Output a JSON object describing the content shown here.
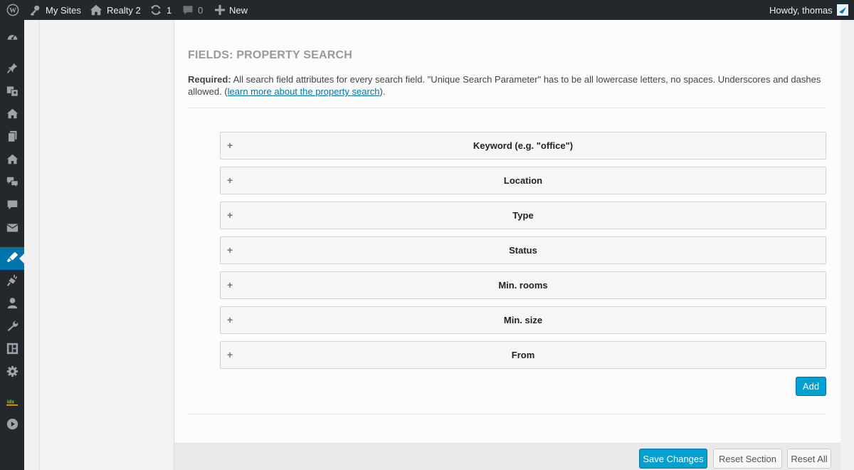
{
  "adminbar": {
    "wp_logo": "wordpress-icon",
    "my_sites": "My Sites",
    "site_name": "Realty 2",
    "updates_count": "1",
    "comments_count": "0",
    "new_label": "New",
    "howdy": "Howdy, thomas"
  },
  "menu": {
    "items": [
      {
        "icon": "dashboard-icon"
      },
      {
        "icon": "pin-icon"
      },
      {
        "icon": "media-icon"
      },
      {
        "icon": "home-icon"
      },
      {
        "icon": "pages-icon"
      },
      {
        "icon": "home-icon"
      },
      {
        "icon": "testimonials-icon"
      },
      {
        "icon": "comments-icon"
      },
      {
        "icon": "mail-icon"
      },
      {
        "icon": "appearance-icon",
        "current": true
      },
      {
        "icon": "plugins-icon"
      },
      {
        "icon": "users-icon"
      },
      {
        "icon": "tools-icon"
      },
      {
        "icon": "widgets-icon"
      },
      {
        "icon": "settings-icon"
      },
      {
        "icon": "idx-icon"
      },
      {
        "icon": "play-icon"
      }
    ]
  },
  "section": {
    "title": "FIELDS: PROPERTY SEARCH",
    "required_label": "Required:",
    "desc_text": " All search field attributes for every search field. \"Unique Search Parameter\" has to be all lowercase letters, no spaces. Underscores and dashes allowed. (",
    "link_text": "learn more about the property search",
    "desc_end": ")."
  },
  "fields": [
    {
      "label": "Keyword (e.g. \"office\")"
    },
    {
      "label": "Location"
    },
    {
      "label": "Type"
    },
    {
      "label": "Status"
    },
    {
      "label": "Min. rooms"
    },
    {
      "label": "Min. size"
    },
    {
      "label": "From"
    }
  ],
  "add_button": "Add",
  "footer": {
    "save": "Save Changes",
    "reset_section": "Reset Section",
    "reset_all": "Reset All"
  },
  "colors": {
    "adminbar_bg": "#23282d",
    "accent": "#0073aa",
    "primary_button": "#00a0d2"
  }
}
